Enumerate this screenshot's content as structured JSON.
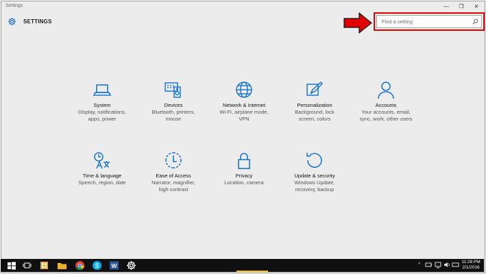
{
  "window": {
    "title": "Settings",
    "min": "—",
    "max": "❐",
    "close": "✕"
  },
  "header": {
    "title": "SETTINGS",
    "icon": "gear-icon"
  },
  "search": {
    "placeholder": "Find a setting",
    "icon": "search-icon"
  },
  "annotation": {
    "color": "#e00000"
  },
  "tiles": [
    {
      "name": "System",
      "desc1": "Display, notifications,",
      "desc2": "apps, power",
      "icon": "laptop-icon"
    },
    {
      "name": "Devices",
      "desc1": "Bluetooth, printers,",
      "desc2": "mouse",
      "icon": "devices-icon"
    },
    {
      "name": "Network & Internet",
      "desc1": "Wi-Fi, airplane mode,",
      "desc2": "VPN",
      "icon": "globe-icon"
    },
    {
      "name": "Personalization",
      "desc1": "Background, lock",
      "desc2": "screen, colors",
      "icon": "paint-icon"
    },
    {
      "name": "Accounts",
      "desc1": "Your accounts, email,",
      "desc2": "sync, work, other users",
      "icon": "person-icon"
    },
    {
      "name": "Time & language",
      "desc1": "Speech, region, date",
      "desc2": "",
      "icon": "time-language-icon"
    },
    {
      "name": "Ease of Access",
      "desc1": "Narrator, magnifier,",
      "desc2": "high contrast",
      "icon": "ease-of-access-icon"
    },
    {
      "name": "Privacy",
      "desc1": "Location, camera",
      "desc2": "",
      "icon": "lock-icon"
    },
    {
      "name": "Update & security",
      "desc1": "Windows Update,",
      "desc2": "recovery, backup",
      "icon": "update-icon"
    }
  ],
  "taskbar": {
    "time": "11:28 PM",
    "date": "2/1/2016",
    "tray_chevron": "^",
    "colors": {
      "background": "#101010",
      "accent": "#1976d2"
    }
  }
}
